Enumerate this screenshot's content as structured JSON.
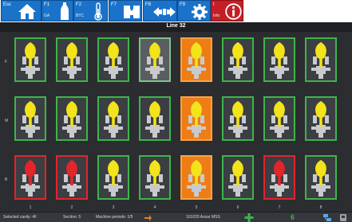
{
  "toolbar": {
    "esc": {
      "key": "Esc",
      "icon": "home-icon"
    },
    "f1": {
      "key": "F1",
      "sub": "GA",
      "icon": "bottle-icon"
    },
    "f2": {
      "key": "F2",
      "sub": "BTC",
      "icon": "thermometer-icon"
    },
    "f7": {
      "key": "F7",
      "icon": "mold-icon"
    },
    "f8": {
      "key": "F8",
      "icon": "transfer-arrows-icon"
    },
    "f9": {
      "key": "F9",
      "icon": "gear-icon"
    },
    "info": {
      "key": "I",
      "sub": "Info",
      "icon": "info-icon"
    }
  },
  "line_title": "Line 32",
  "rows": [
    {
      "label": "F",
      "cavities": [
        "ok",
        "ok",
        "ok",
        "dim",
        "orange",
        "ok",
        "ok",
        "ok"
      ]
    },
    {
      "label": "M",
      "cavities": [
        "ok",
        "ok",
        "ok",
        "ok",
        "orange",
        "ok",
        "ok",
        "ok"
      ]
    },
    {
      "label": "B",
      "cavities": [
        "red",
        "red",
        "ok",
        "ok",
        "orange",
        "ok",
        "red",
        "ok"
      ]
    }
  ],
  "columns": [
    "1",
    "2",
    "3",
    "4",
    "5",
    "6",
    "7",
    "8"
  ],
  "colors": {
    "ok_border": "#3db54a",
    "fault_border": "#e2242b",
    "fault_bottle": "#e2242b",
    "bottle": "#f2e31b",
    "active_bg": "#ee7d16",
    "toolbar_blue": "#1a73c9",
    "info_red": "#c51f25"
  },
  "status": {
    "selected_cavity": "Selected cavity: 4F",
    "section": "Section: 5",
    "machine_periods": "Machine periods: 1/5",
    "job": "101020 Assar MSS",
    "counter": "6"
  }
}
